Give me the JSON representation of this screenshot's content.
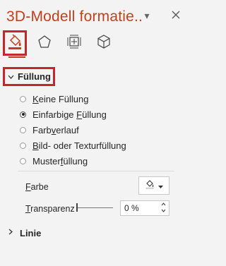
{
  "pane": {
    "title": "3D-Modell formatie..",
    "options_icon": "chevron-down-icon",
    "close_icon": "close-icon"
  },
  "tabs": [
    {
      "name": "fill-and-line",
      "icon": "paint-bucket-icon",
      "active": true
    },
    {
      "name": "effects",
      "icon": "pentagon-icon",
      "active": false
    },
    {
      "name": "size-and-properties",
      "icon": "size-properties-icon",
      "active": false
    },
    {
      "name": "3d-model",
      "icon": "cube-icon",
      "active": false
    }
  ],
  "fill_section": {
    "label": "Füllung",
    "expanded": true,
    "options": [
      {
        "pre": "",
        "key": "K",
        "post": "eine Füllung",
        "selected": false
      },
      {
        "pre": "Einfarbige ",
        "key": "F",
        "post": "üllung",
        "selected": true
      },
      {
        "pre": "Farb",
        "key": "v",
        "post": "erlauf",
        "selected": false
      },
      {
        "pre": "",
        "key": "B",
        "post": "ild- oder Texturfüllung",
        "selected": false
      },
      {
        "pre": "Muster",
        "key": "f",
        "post": "üllung",
        "selected": false
      }
    ],
    "color": {
      "pre": "",
      "key": "F",
      "post": "arbe"
    },
    "transparency": {
      "pre": "",
      "key": "T",
      "post": "ransparenz",
      "value": "0 %",
      "level": 0
    }
  },
  "line_section": {
    "label": "Linie",
    "expanded": false
  },
  "colors": {
    "accent": "#c43e1c",
    "highlight": "#c4262e",
    "background": "#f3f3f3"
  }
}
